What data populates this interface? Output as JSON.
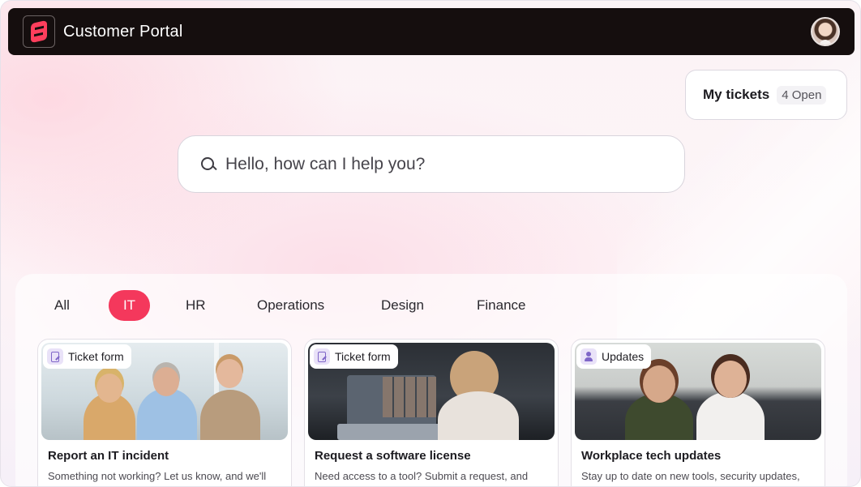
{
  "header": {
    "app_title": "Customer Portal"
  },
  "my_tickets": {
    "label": "My tickets",
    "badge": "4 Open"
  },
  "search": {
    "placeholder": "Hello, how can I help you?"
  },
  "tabs": [
    {
      "label": "All",
      "active": false
    },
    {
      "label": "IT",
      "active": true
    },
    {
      "label": "HR",
      "active": false
    },
    {
      "label": "Operations",
      "active": false
    },
    {
      "label": "Design",
      "active": false
    },
    {
      "label": "Finance",
      "active": false
    }
  ],
  "cards": [
    {
      "badge": "Ticket form",
      "badge_icon": "form-icon",
      "title": "Report an IT incident",
      "description": "Something not working? Let us know, and we'll"
    },
    {
      "badge": "Ticket form",
      "badge_icon": "form-icon",
      "title": "Request a software license",
      "description": "Need access to a tool? Submit a request, and"
    },
    {
      "badge": "Updates",
      "badge_icon": "person-icon",
      "title": "Workplace tech updates",
      "description": "Stay up to date on new tools, security updates,"
    }
  ],
  "colors": {
    "accent": "#f4385c",
    "header_bg": "#150e0e"
  }
}
